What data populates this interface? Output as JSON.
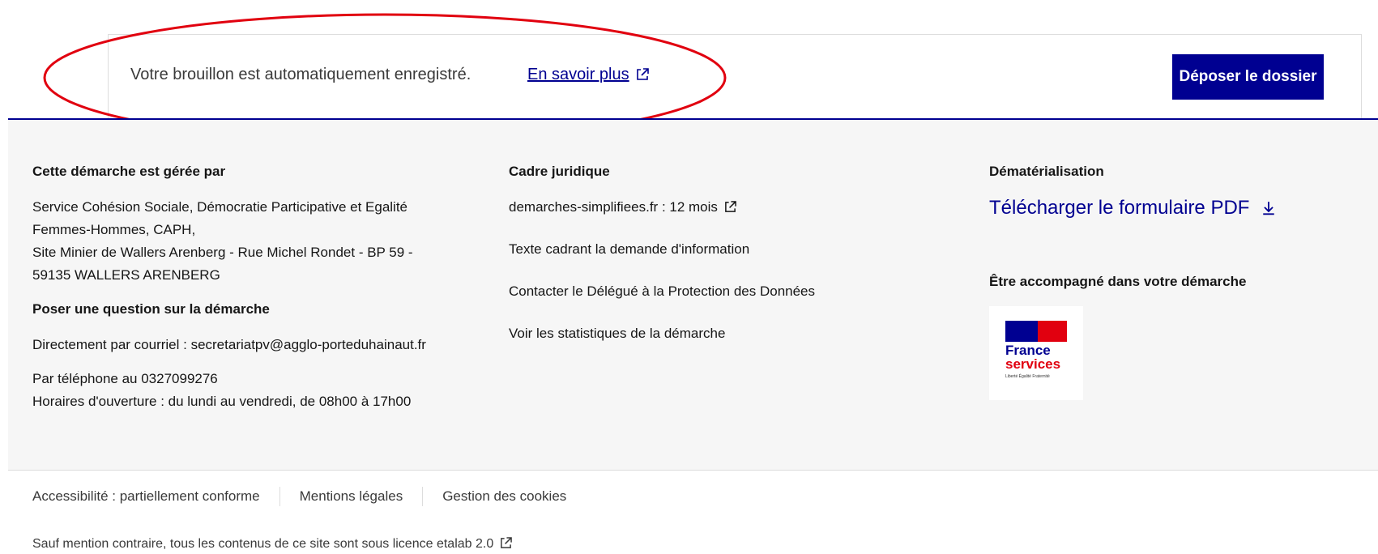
{
  "submit_bar": {
    "draft_text": "Votre brouillon est automatiquement enregistré.",
    "learn_more": "En savoir plus",
    "submit_label": "Déposer le dossier"
  },
  "footer": {
    "managed_by": {
      "heading": "Cette démarche est gérée par",
      "line1": "Service Cohésion Sociale, Démocratie Participative et Egalité",
      "line2": "Femmes-Hommes, CAPH,",
      "line3": "Site Minier de Wallers Arenberg - Rue Michel Rondet - BP 59 -",
      "line4": "59135 WALLERS ARENBERG"
    },
    "question": {
      "heading": "Poser une question sur la démarche",
      "email": "Directement par courriel : secretariatpv@agglo-porteduhainaut.fr",
      "phone": "Par téléphone au 0327099276",
      "hours": "Horaires d'ouverture : du lundi au vendredi, de 08h00 à 17h00"
    },
    "legal": {
      "heading": "Cadre juridique",
      "links": [
        "demarches-simplifiees.fr : 12 mois",
        "Texte cadrant la demande d'information",
        "Contacter le Délégué à la Protection des Données",
        "Voir les statistiques de la démarche"
      ]
    },
    "dematerialisation": {
      "heading": "Dématérialisation",
      "pdf_link": "Télécharger le formulaire PDF",
      "support_heading": "Être accompagné dans votre démarche",
      "logo_line1": "France",
      "logo_line2": "services",
      "logo_motto": "Liberté Égalité Fraternité"
    }
  },
  "bottom": {
    "links": [
      "Accessibilité : partiellement conforme",
      "Mentions légales",
      "Gestion des cookies"
    ],
    "license": "Sauf mention contraire, tous les contenus de ce site sont sous licence etalab 2.0"
  },
  "colors": {
    "primary": "#000091",
    "annotation": "#e1000f"
  }
}
